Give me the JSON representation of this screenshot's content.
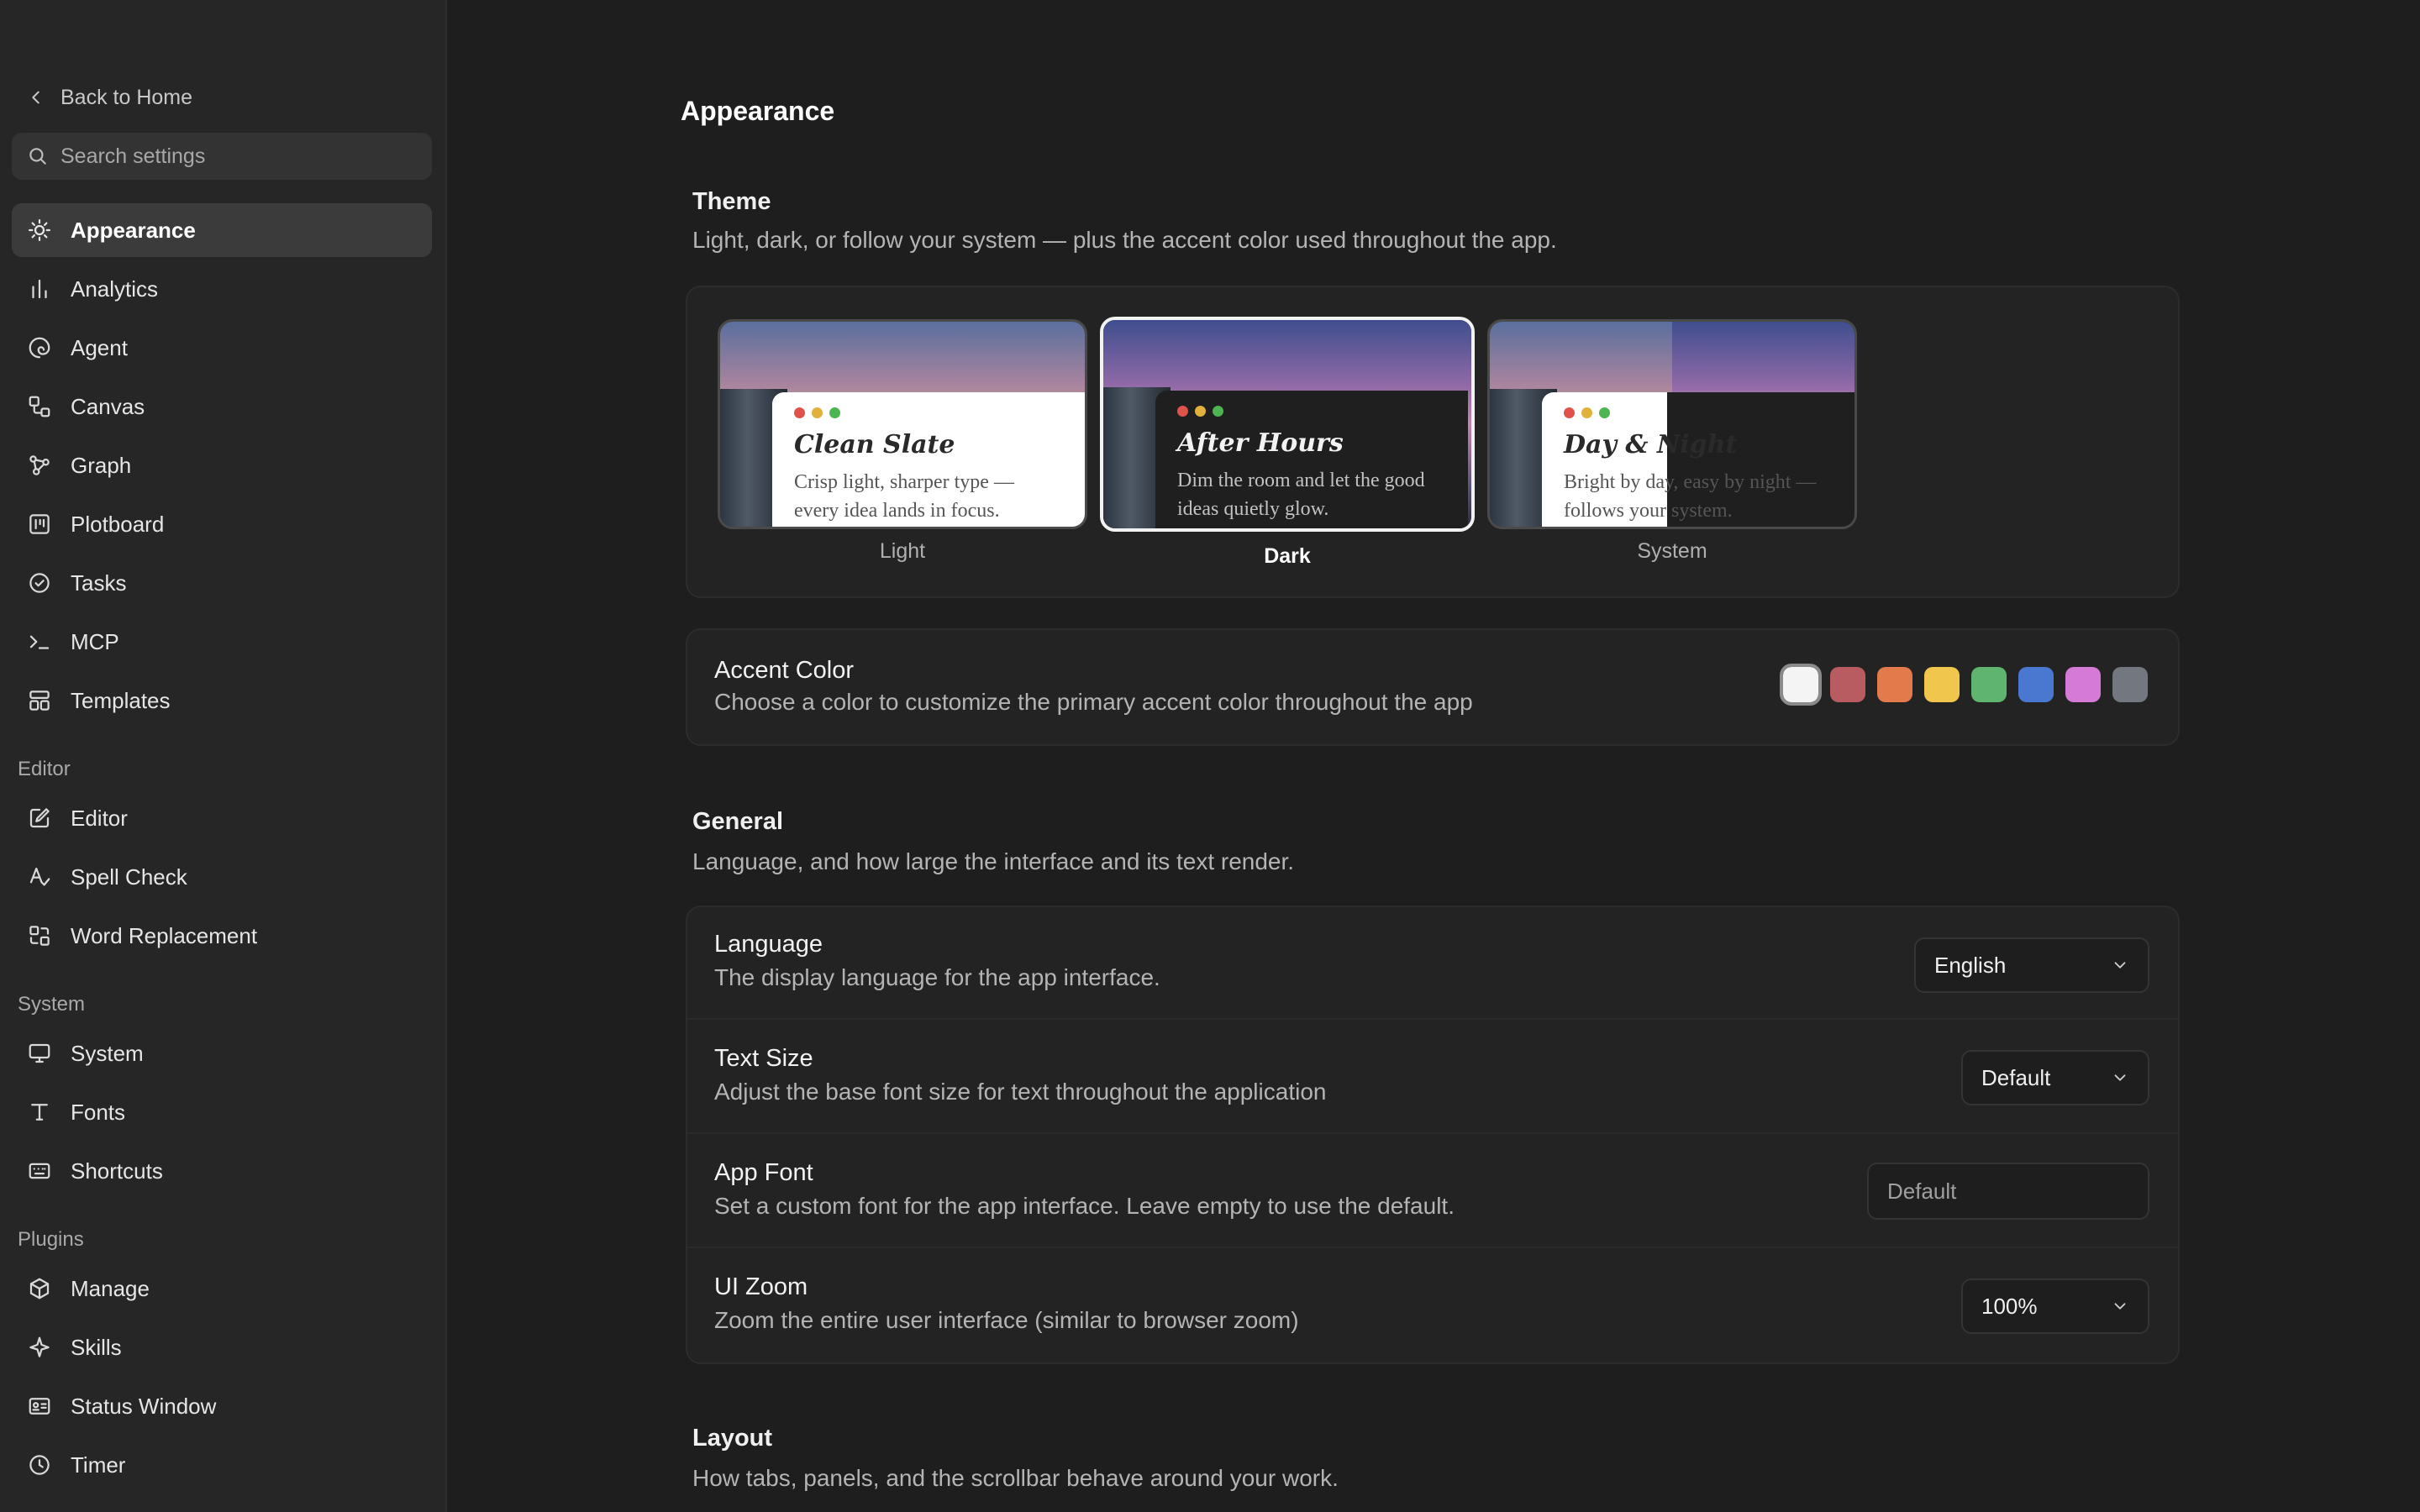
{
  "sidebar": {
    "back_label": "Back to Home",
    "search_placeholder": "Search settings",
    "items": [
      {
        "label": "Appearance"
      },
      {
        "label": "Analytics"
      },
      {
        "label": "Agent"
      },
      {
        "label": "Canvas"
      },
      {
        "label": "Graph"
      },
      {
        "label": "Plotboard"
      },
      {
        "label": "Tasks"
      },
      {
        "label": "MCP"
      },
      {
        "label": "Templates"
      }
    ],
    "sections": [
      {
        "label": "Editor",
        "items": [
          {
            "label": "Editor"
          },
          {
            "label": "Spell Check"
          },
          {
            "label": "Word Replacement"
          }
        ]
      },
      {
        "label": "System",
        "items": [
          {
            "label": "System"
          },
          {
            "label": "Fonts"
          },
          {
            "label": "Shortcuts"
          }
        ]
      },
      {
        "label": "Plugins",
        "items": [
          {
            "label": "Manage"
          },
          {
            "label": "Skills"
          },
          {
            "label": "Status Window"
          },
          {
            "label": "Timer"
          }
        ]
      }
    ]
  },
  "main": {
    "page_title": "Appearance",
    "theme": {
      "title": "Theme",
      "description": "Light, dark, or follow your system — plus the accent color used throughout the app.",
      "options": [
        {
          "name": "Clean Slate",
          "tagline": "Crisp light, sharper type — every idea lands in focus.",
          "label": "Light"
        },
        {
          "name": "After Hours",
          "tagline": "Dim the room and let the good ideas quietly glow.",
          "label": "Dark"
        },
        {
          "name": "Day & Night",
          "tagline": "Bright by day, easy by night — follows your system.",
          "label": "System"
        }
      ],
      "selected": "Dark"
    },
    "accent": {
      "title": "Accent Color",
      "description": "Choose a color to customize the primary accent color throughout the app",
      "colors": [
        "#f4f4f4",
        "#b85c62",
        "#e27a4c",
        "#f0c64c",
        "#5fb56f",
        "#4a78d0",
        "#d57ad6",
        "#737880"
      ],
      "selected_index": 0
    },
    "general": {
      "title": "General",
      "description": "Language, and how large the interface and its text render.",
      "language": {
        "title": "Language",
        "description": "The display language for the app interface.",
        "value": "English"
      },
      "text_size": {
        "title": "Text Size",
        "description": "Adjust the base font size for text throughout the application",
        "value": "Default"
      },
      "app_font": {
        "title": "App Font",
        "description": "Set a custom font for the app interface. Leave empty to use the default.",
        "placeholder": "Default"
      },
      "ui_zoom": {
        "title": "UI Zoom",
        "description": "Zoom the entire user interface (similar to browser zoom)",
        "value": "100%"
      }
    },
    "layout": {
      "title": "Layout",
      "description": "How tabs, panels, and the scrollbar behave around your work."
    }
  }
}
